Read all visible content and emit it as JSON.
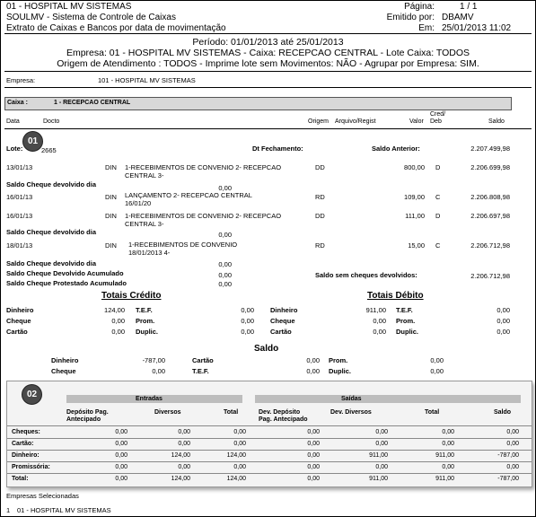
{
  "header": {
    "hospital": "01 - HOSPITAL MV SISTEMAS",
    "system": "SOULMV - Sistema de Controle de Caixas",
    "report": "Extrato de Caixas e Bancos por data de movimentação",
    "pagina_label": "Página:",
    "pagina_value": "1 / 1",
    "emitido_label": "Emitido por:",
    "emitido_value": "DBAMV",
    "em_label": "Em:",
    "em_value": "25/01/2013 11:02"
  },
  "filters": {
    "periodo": "Período: 01/01/2013 até 25/01/2013",
    "line2": "Empresa: 01 - HOSPITAL MV SISTEMAS  -  Caixa: RECEPCAO CENTRAL  -  Lote Caixa: TODOS",
    "line3": "Origem de Atendimento : TODOS  -  Imprime lote sem Movimentos: NÃO  -  Agrupar por Empresa: SIM."
  },
  "empresa": {
    "label": "Empresa:",
    "value": "101 - HOSPITAL MV SISTEMAS"
  },
  "caixa": {
    "label": "Caixa :",
    "value": "1 - RECEPCAO CENTRAL"
  },
  "columns": {
    "data": "Data",
    "docto": "Docto",
    "origem": "Origem",
    "arquivo": "Arquivo/Regist",
    "valor": "Valor",
    "cred": "Cred/",
    "deb": "Deb",
    "saldo": "Saldo"
  },
  "lote": {
    "label": "Lote:",
    "value": "2665",
    "fechamento_label": "Dt Fechamento:",
    "saldo_anterior_label": "Saldo Anterior:",
    "saldo_anterior_value": "2.207.499,98"
  },
  "entries": [
    {
      "date": "13/01/13",
      "doc": "DIN",
      "desc1": "1-RECEBIMENTOS DE CONVENIO 2- RECEPCAO",
      "desc2": "CENTRAL  3-",
      "origem": "DD",
      "valor": "800,00",
      "cd": "D",
      "saldo": "2.206.699,98",
      "cheque_label": "Saldo Cheque devolvido dia",
      "cheque_value": "0,00"
    },
    {
      "date": "16/01/13",
      "doc": "DIN",
      "desc1": "LANÇAMENTO 2- RECEPCAO CENTRAL",
      "desc2": "16/01/20",
      "origem": "RD",
      "valor": "109,00",
      "cd": "C",
      "saldo": "2.206.808,98",
      "cheque_label": "",
      "cheque_value": ""
    },
    {
      "date": "16/01/13",
      "doc": "DIN",
      "desc1": "1-RECEBIMENTOS DE CONVENIO 2- RECEPCAO",
      "desc2": "CENTRAL  3-",
      "origem": "DD",
      "valor": "111,00",
      "cd": "D",
      "saldo": "2.206.697,98",
      "cheque_label": "Saldo Cheque devolvido dia",
      "cheque_value": "0,00"
    },
    {
      "date": "18/01/13",
      "doc": "DIN",
      "desc1": "1-RECEBIMENTOS DE CONVENIO",
      "desc2": "18/01/2013 4-",
      "origem": "RD",
      "valor": "15,00",
      "cd": "C",
      "saldo": "2.206.712,98",
      "cheque_label": "Saldo Cheque devolvido dia",
      "cheque_value": "0,00"
    }
  ],
  "summary": {
    "acumulado_label": "Saldo Cheque Devolvido Acumulado",
    "acumulado_value": "0,00",
    "protestado_label": "Saldo Cheque Protestado Acumulado",
    "protestado_value": "0,00",
    "sem_cheques_label": "Saldo sem cheques devolvidos:",
    "sem_cheques_value": "2.206.712,98"
  },
  "totais_credito": {
    "title": "Totais Crédito",
    "rows": [
      {
        "l1": "Dinheiro",
        "v1": "124,00",
        "l2": "T.E.F.",
        "v2": "0,00"
      },
      {
        "l1": "Cheque",
        "v1": "0,00",
        "l2": "Prom.",
        "v2": "0,00"
      },
      {
        "l1": "Cartão",
        "v1": "0,00",
        "l2": "Duplic.",
        "v2": "0,00"
      }
    ]
  },
  "totais_debito": {
    "title": "Totais Débito",
    "rows": [
      {
        "l1": "Dinheiro",
        "v1": "911,00",
        "l2": "T.E.F.",
        "v2": "0,00"
      },
      {
        "l1": "Cheque",
        "v1": "0,00",
        "l2": "Prom.",
        "v2": "0,00"
      },
      {
        "l1": "Cartão",
        "v1": "0,00",
        "l2": "Duplic.",
        "v2": "0,00"
      }
    ]
  },
  "saldo": {
    "title": "Saldo",
    "rows": [
      {
        "l1": "Dinheiro",
        "v1": "-787,00",
        "l2": "Cartão",
        "v2": "0,00",
        "l3": "Prom.",
        "v3": "0,00"
      },
      {
        "l1": "Cheque",
        "v1": "0,00",
        "l2": "T.E.F.",
        "v2": "0,00",
        "l3": "Duplic.",
        "v3": "0,00"
      }
    ]
  },
  "badges": {
    "b1": "01",
    "b2": "02"
  },
  "panel": {
    "entradas": "Entradas",
    "saidas": "Saídas",
    "cols": {
      "dep_ant_1": "Depósito Pag.",
      "dep_ant_2": "Antecipado",
      "diversos": "Diversos",
      "total": "Total",
      "dev_dep_1": "Dev. Depósito",
      "dev_dep_2": "Pag. Antecipado",
      "dev_div": "Dev. Diversos",
      "total2": "Total",
      "saldo": "Saldo"
    },
    "rows": [
      {
        "label": "Cheques:",
        "v": [
          "0,00",
          "0,00",
          "0,00",
          "0,00",
          "0,00",
          "0,00",
          "0,00"
        ]
      },
      {
        "label": "Cartão:",
        "v": [
          "0,00",
          "0,00",
          "0,00",
          "0,00",
          "0,00",
          "0,00",
          "0,00"
        ]
      },
      {
        "label": "Dinheiro:",
        "v": [
          "0,00",
          "124,00",
          "124,00",
          "0,00",
          "911,00",
          "911,00",
          "-787,00"
        ]
      },
      {
        "label": "Promissória:",
        "v": [
          "0,00",
          "0,00",
          "0,00",
          "0,00",
          "0,00",
          "0,00",
          "0,00"
        ]
      },
      {
        "label": "Total:",
        "v": [
          "0,00",
          "124,00",
          "124,00",
          "0,00",
          "911,00",
          "911,00",
          "-787,00"
        ]
      }
    ]
  },
  "footer": {
    "title": "Empresas Selecionadas",
    "index": "1",
    "empresa": "01 - HOSPITAL MV SISTEMAS"
  }
}
